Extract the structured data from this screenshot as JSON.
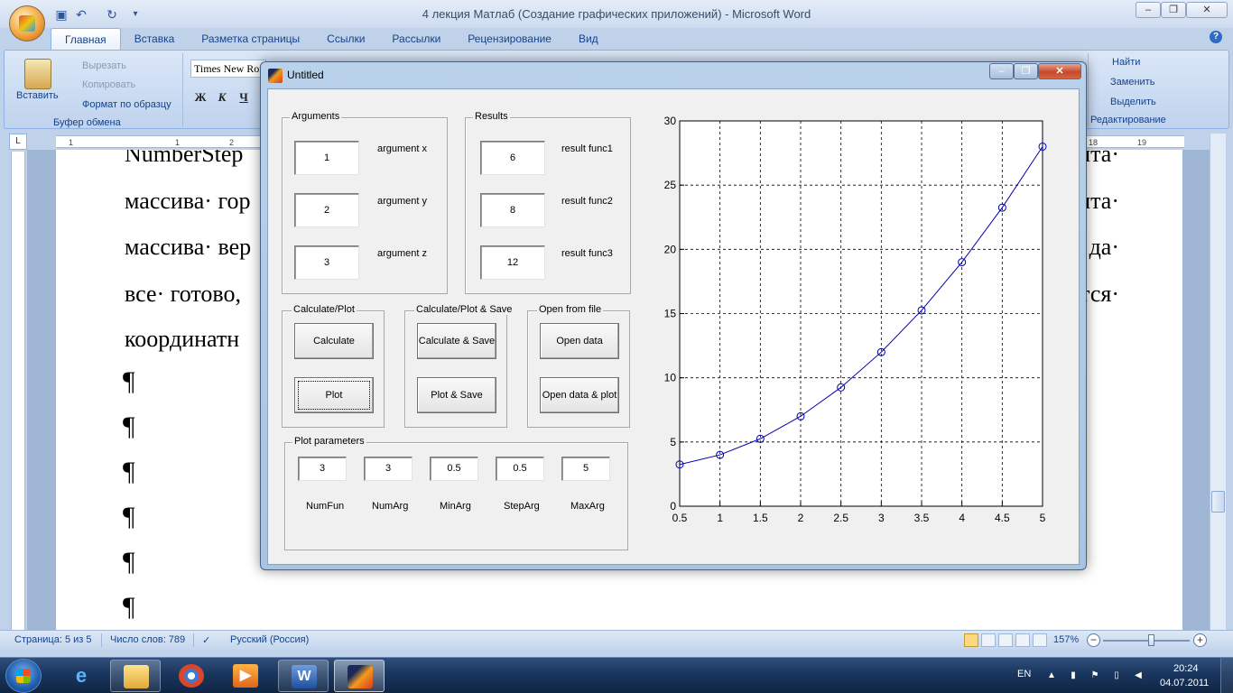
{
  "word": {
    "title": "4 лекция Матлаб (Создание графических приложений) - Microsoft Word",
    "tabs": [
      "Главная",
      "Вставка",
      "Разметка страницы",
      "Ссылки",
      "Рассылки",
      "Рецензирование",
      "Вид"
    ],
    "active_tab": "Главная",
    "clipboard": {
      "paste": "Вставить",
      "cut": "Вырезать",
      "copy": "Копировать",
      "format_painter": "Формат по образцу",
      "group_label": "Буфер обмена"
    },
    "font": {
      "name": "Times New Roman",
      "bold": "Ж",
      "italic": "К",
      "underline": "Ч"
    },
    "editing": {
      "find": "Найти",
      "replace": "Заменить",
      "select": "Выделить",
      "group_label": "Редактирование"
    },
    "ruler_numbers": [
      "1",
      "1",
      "2",
      "18",
      "19"
    ],
    "document": {
      "line1_left": "NumberStep",
      "line1_right": "нта·",
      "line2_left": "массива· гор",
      "line2_right": "нта·",
      "line3_left": "массива· вер",
      "line3_right": "да·",
      "line4_left": "все· готово,",
      "line4_right": "тся·",
      "line5_left": "координатн",
      "pilcrow": "¶"
    },
    "status": {
      "page": "Страница: 5 из 5",
      "words": "Число слов: 789",
      "language": "Русский (Россия)",
      "zoom": "157%"
    }
  },
  "figure": {
    "title": "Untitled",
    "arguments_panel": {
      "title": "Arguments",
      "fields": [
        {
          "value": "1",
          "label": "argument x"
        },
        {
          "value": "2",
          "label": "argument y"
        },
        {
          "value": "3",
          "label": "argument z"
        }
      ]
    },
    "results_panel": {
      "title": "Results",
      "fields": [
        {
          "value": "6",
          "label": "result func1"
        },
        {
          "value": "8",
          "label": "result func2"
        },
        {
          "value": "12",
          "label": "result func3"
        }
      ]
    },
    "calc_panel": {
      "title": "Calculate/Plot",
      "btn1": "Calculate",
      "btn2": "Plot"
    },
    "save_panel": {
      "title": "Calculate/Plot & Save",
      "btn1": "Calculate & Save",
      "btn2": "Plot & Save"
    },
    "file_panel": {
      "title": "Open from file",
      "btn1": "Open data",
      "btn2": "Open data & plot"
    },
    "params_panel": {
      "title": "Plot parameters",
      "fields": [
        {
          "value": "3",
          "label": "NumFun"
        },
        {
          "value": "3",
          "label": "NumArg"
        },
        {
          "value": "0.5",
          "label": "MinArg"
        },
        {
          "value": "0.5",
          "label": "StepArg"
        },
        {
          "value": "5",
          "label": "MaxArg"
        }
      ]
    },
    "chart_data": {
      "type": "line",
      "x": [
        0.5,
        1,
        1.5,
        2,
        2.5,
        3,
        3.5,
        4,
        4.5,
        5
      ],
      "series": [
        {
          "values": [
            3.25,
            4,
            5.25,
            7,
            9.25,
            12,
            15.25,
            19,
            23.25,
            28
          ],
          "color": "#0000b0",
          "marker": "circle"
        }
      ],
      "xlim": [
        0.5,
        5
      ],
      "ylim": [
        0,
        30
      ],
      "xticks": [
        "0.5",
        "1",
        "1.5",
        "2",
        "2.5",
        "3",
        "3.5",
        "4",
        "4.5",
        "5"
      ],
      "yticks": [
        "0",
        "5",
        "10",
        "15",
        "20",
        "25",
        "30"
      ],
      "grid": true
    }
  },
  "taskbar": {
    "lang": "EN",
    "time": "20:24",
    "date": "04.07.2011"
  }
}
